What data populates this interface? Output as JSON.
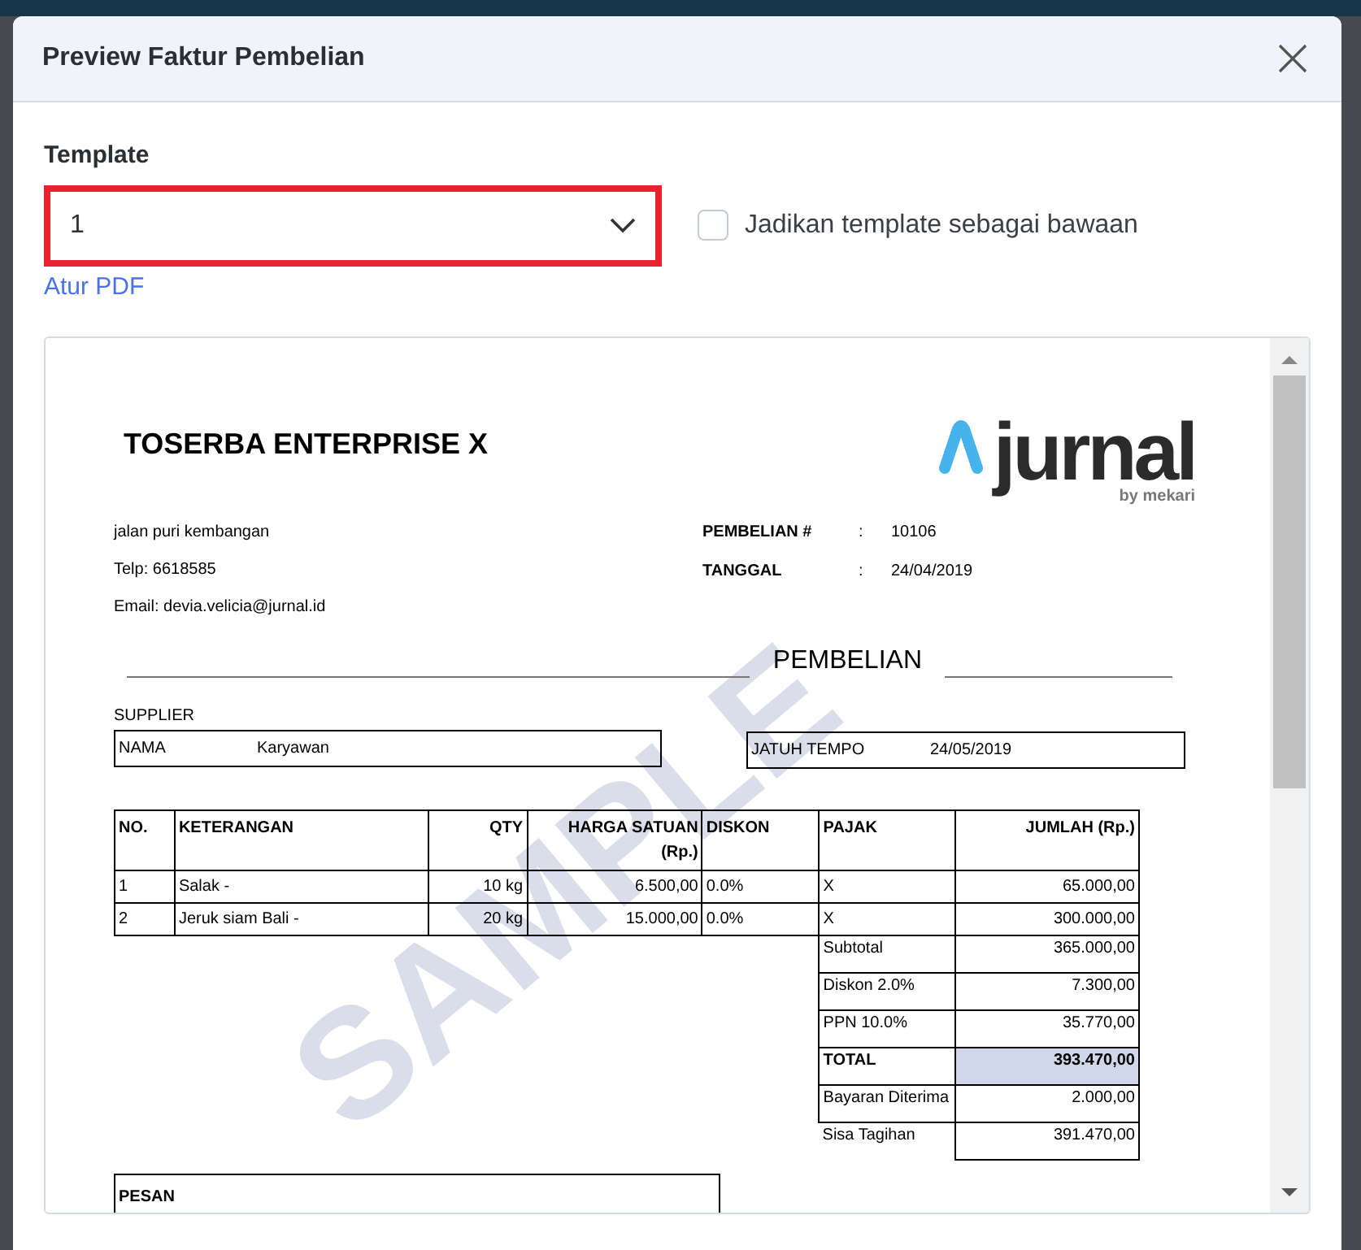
{
  "modal": {
    "title": "Preview Faktur Pembelian"
  },
  "template": {
    "label": "Template",
    "value": "1",
    "checkbox": {
      "label": "Jadikan template sebagai bawaan",
      "checked": false
    },
    "link": "Atur PDF"
  },
  "document": {
    "company": "TOSERBA ENTERPRISE X",
    "logo": {
      "word": "jurnal",
      "tagline": "by mekari"
    },
    "address_lines": [
      "jalan puri kembangan",
      "Telp: 6618585",
      "Email: devia.velicia@jurnal.id"
    ],
    "meta": [
      {
        "label": "PEMBELIAN #",
        "separator": ":",
        "value": "10106"
      },
      {
        "label": "TANGGAL",
        "separator": ":",
        "value": "24/04/2019"
      }
    ],
    "heading": "PEMBELIAN",
    "watermark": "SAMPLE",
    "supplier_label": "SUPPLIER",
    "supplier": {
      "label": "NAMA",
      "value": "Karyawan"
    },
    "due": {
      "label": "JATUH TEMPO",
      "value": "24/05/2019"
    },
    "columns": [
      {
        "label": "NO.",
        "numeric": false
      },
      {
        "label": "KETERANGAN",
        "numeric": false
      },
      {
        "label": "QTY",
        "numeric": true
      },
      {
        "label": "HARGA SATUAN (Rp.)",
        "numeric": true
      },
      {
        "label": "DISKON",
        "numeric": false
      },
      {
        "label": "PAJAK",
        "numeric": false
      },
      {
        "label": "JUMLAH (Rp.)",
        "numeric": true
      }
    ],
    "rows": [
      [
        "1",
        "Salak -",
        "10 kg",
        "6.500,00",
        "0.0%",
        "X",
        "65.000,00"
      ],
      [
        "2",
        "Jeruk siam Bali -",
        "20 kg",
        "15.000,00",
        "0.0%",
        "X",
        "300.000,00"
      ]
    ],
    "summary": [
      {
        "kind": "row",
        "label": "Subtotal",
        "value": "365.000,00"
      },
      {
        "kind": "row",
        "label": "Diskon 2.0%",
        "value": "7.300,00"
      },
      {
        "kind": "row",
        "label": "PPN 10.0%",
        "value": "35.770,00"
      },
      {
        "kind": "total",
        "label": "TOTAL",
        "value": "393.470,00"
      },
      {
        "kind": "row",
        "label": "Bayaran Diterima",
        "value": "2.000,00"
      },
      {
        "kind": "balance",
        "label": "Sisa Tagihan",
        "value": "391.470,00"
      }
    ],
    "message_label": "PESAN"
  }
}
